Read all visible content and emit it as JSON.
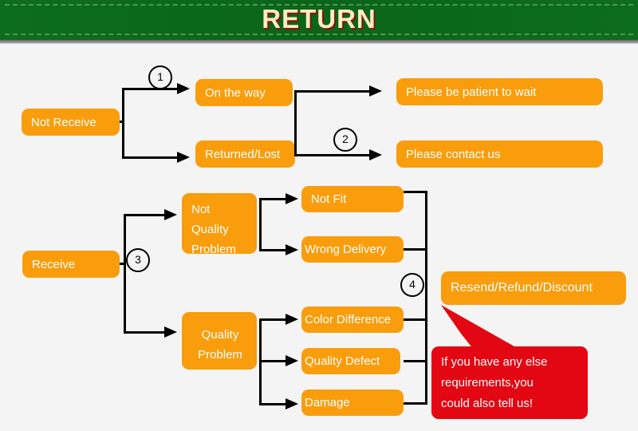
{
  "header": {
    "title": "RETURN",
    "background_color": "#0b6b1c",
    "title_color": "#fbeec2",
    "title_shadow_color": "#8c1408"
  },
  "theme": {
    "background_color": "#f4f4f4",
    "box_color": "#f99d0c",
    "box_text_color": "#ffffff",
    "connector_color": "#000000",
    "callout_color": "#e30613"
  },
  "flow": {
    "branch_not_receive": {
      "root": "Not Receive",
      "marker": "1",
      "states": [
        {
          "label": "On the way",
          "outcome": "Please be patient to wait"
        },
        {
          "label": "Returned/Lost",
          "outcome": "Please contact us"
        }
      ],
      "outcome_marker": "2"
    },
    "branch_receive": {
      "root": "Receive",
      "marker": "3",
      "categories": [
        {
          "label": "Not Quality Problem",
          "label_lines": [
            "Not",
            "Quality",
            "Problem"
          ],
          "reasons": [
            "Not Fit",
            "Wrong Delivery"
          ]
        },
        {
          "label": "Quality Problem",
          "label_lines": [
            "Quality",
            "Problem"
          ],
          "reasons": [
            "Color Difference",
            "Quality Defect",
            "Damage"
          ]
        }
      ],
      "resolution_marker": "4",
      "resolution": "Resend/Refund/Discount"
    }
  },
  "callout": {
    "lines": [
      "If you have any else",
      "requirements,you",
      "could also tell us!"
    ]
  }
}
